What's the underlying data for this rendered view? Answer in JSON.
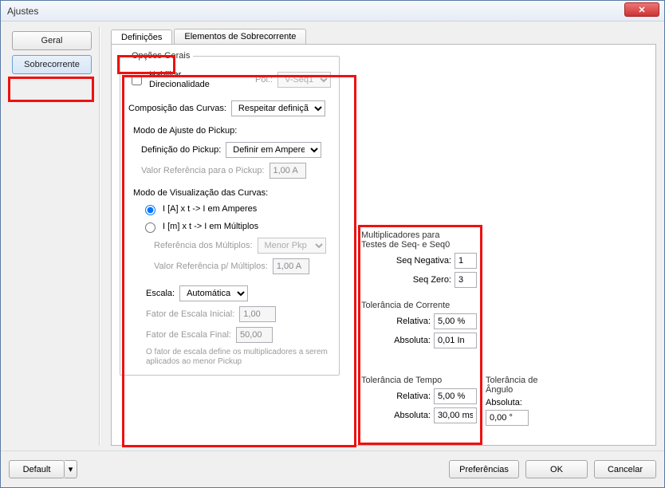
{
  "window": {
    "title": "Ajustes"
  },
  "leftnav": {
    "general": "Geral",
    "sobre": "Sobrecorrente"
  },
  "tabs": {
    "def": "Definições",
    "elem": "Elementos de Sobrecorrente"
  },
  "opcoes": {
    "legend": "Opções Gerais",
    "hab_dir": "Habilitar Direcionalidade",
    "pol_label": "Pol.:",
    "pol_value": "V-Seq1",
    "comp_label": "Composição das Curvas:",
    "comp_value": "Respeitar definição",
    "pickup_mode_label": "Modo de Ajuste do Pickup:",
    "pickup_def_label": "Definição do Pickup:",
    "pickup_def_value": "Definir em Amperes",
    "pickup_ref_label": "Valor Referência para o Pickup:",
    "pickup_ref_value": "1,00 A",
    "viz_label": "Modo de Visualização das Curvas:",
    "viz_amp": "I [A] x t -> I em Amperes",
    "viz_mult": "I [m] x t -> I em Múltiplos",
    "ref_mult_label": "Referência dos Múltiplos:",
    "ref_mult_value": "Menor Pkp",
    "val_ref_mult_label": "Valor Referência p/ Múltiplos:",
    "val_ref_mult_value": "1,00 A",
    "escala_label": "Escala:",
    "escala_value": "Automática",
    "fei_label": "Fator de Escala Inicial:",
    "fei_value": "1,00",
    "fef_label": "Fator de Escala Final:",
    "fef_value": "50,00",
    "note": "O fator de escala define os multiplicadores a serem aplicados ao menor Pickup"
  },
  "mult": {
    "title": "Multiplicadores para Testes de Seq- e Seq0",
    "neg_label": "Seq Negativa:",
    "neg_value": "1",
    "zero_label": "Seq Zero:",
    "zero_value": "3"
  },
  "tol_corr": {
    "title": "Tolerância de Corrente",
    "rel_label": "Relativa:",
    "rel_value": "5,00 %",
    "abs_label": "Absoluta:",
    "abs_value": "0,01 In"
  },
  "tol_temp": {
    "title": "Tolerância de Tempo",
    "rel_label": "Relativa:",
    "rel_value": "5,00 %",
    "abs_label": "Absoluta:",
    "abs_value": "30,00 ms"
  },
  "tol_ang": {
    "title": "Tolerância de Ângulo",
    "abs_label": "Absoluta:",
    "abs_value": "0,00 °"
  },
  "buttons": {
    "default": "Default",
    "pref": "Preferências",
    "ok": "OK",
    "cancel": "Cancelar"
  }
}
